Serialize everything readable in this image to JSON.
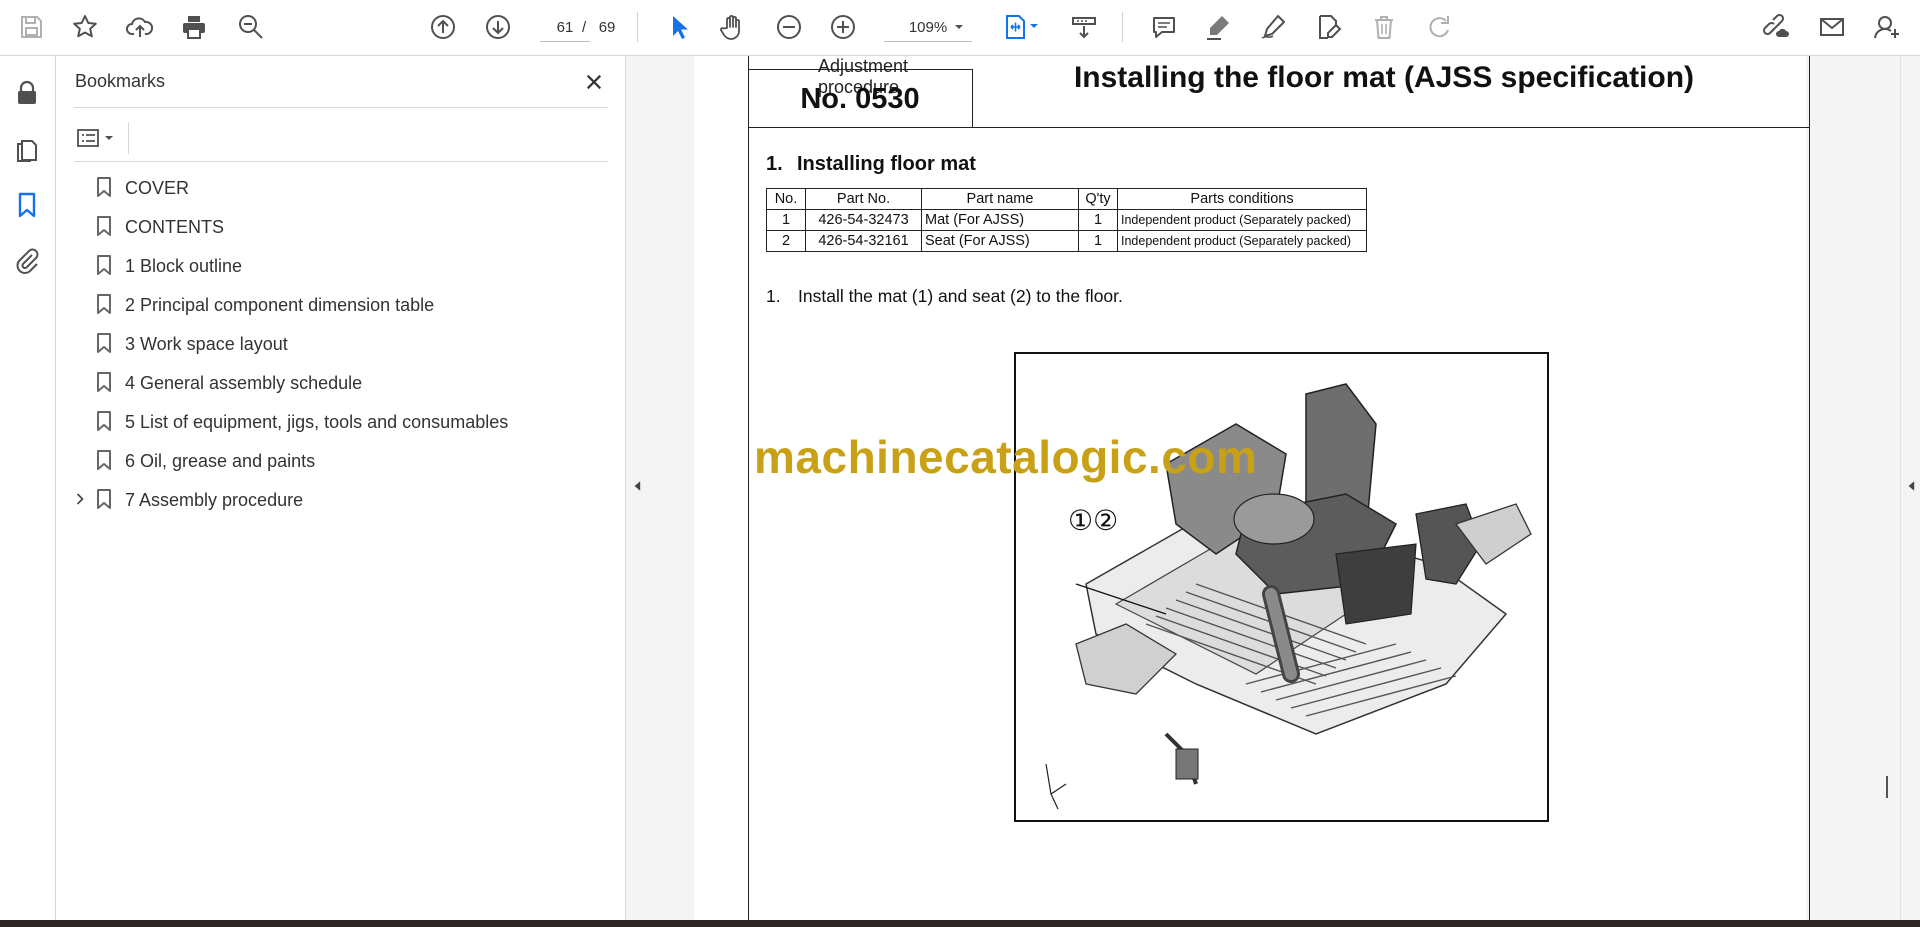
{
  "toolbar": {
    "current_page": "61",
    "page_separator": "/",
    "total_pages": "69",
    "zoom": "109%",
    "icons": [
      "save-icon",
      "star-icon",
      "upload-icon",
      "print-icon",
      "zoom-search-icon",
      "page-up-icon",
      "page-down-icon",
      "select-cursor-icon",
      "hand-icon",
      "zoom-out-icon",
      "zoom-in-icon",
      "chevron-down-icon",
      "fit-page-icon",
      "chevron-down-icon",
      "scroll-mode-icon",
      "comment-icon",
      "highlight-icon",
      "draw-icon",
      "fill-sign-icon",
      "delete-icon",
      "redo-icon",
      "share-link-icon",
      "email-icon",
      "account-icon"
    ]
  },
  "left_rail": {
    "icons": [
      "lock-icon",
      "pages-icon",
      "bookmark-icon",
      "attachment-icon"
    ]
  },
  "bookmarks_panel": {
    "title": "Bookmarks",
    "items": [
      {
        "label": "COVER"
      },
      {
        "label": "CONTENTS"
      },
      {
        "label": "1 Block outline"
      },
      {
        "label": "2 Principal component dimension table"
      },
      {
        "label": "3 Work space layout"
      },
      {
        "label": "4 General assembly schedule"
      },
      {
        "label": "5 List of equipment, jigs, tools and consumables"
      },
      {
        "label": "6 Oil, grease and paints"
      },
      {
        "label": "7 Assembly procedure"
      }
    ]
  },
  "document": {
    "category_label": "Adjustment procedure",
    "doc_number": "No. 0530",
    "title": "Installing the floor mat (AJSS specification)",
    "section_number": "1.",
    "section_title": "Installing floor mat",
    "table": {
      "headers": [
        "No.",
        "Part No.",
        "Part name",
        "Q'ty",
        "Parts conditions"
      ],
      "rows": [
        [
          "1",
          "426-54-32473",
          "Mat (For AJSS)",
          "1",
          "Independent product (Separately packed)"
        ],
        [
          "2",
          "426-54-32161",
          "Seat (For AJSS)",
          "1",
          "Independent product (Separately packed)"
        ]
      ]
    },
    "step_number": "1.",
    "step_text": "Install the mat (1) and seat (2) to the floor.",
    "figure_callout": "①②",
    "watermark": "machinecatalogic.com"
  },
  "colors": {
    "accent_blue": "#1473e6",
    "watermark": "#c9a117",
    "icon_gray": "#505050"
  }
}
